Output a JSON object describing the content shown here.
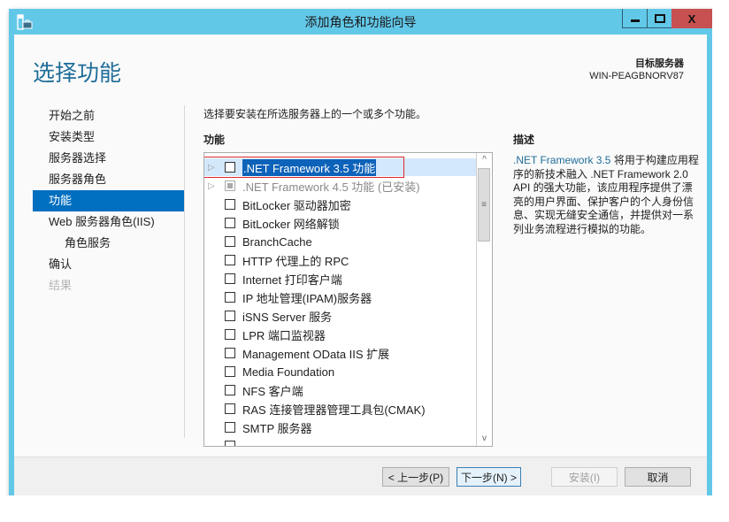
{
  "window": {
    "title": "添加角色和功能向导",
    "controls": {
      "minimize": "▁",
      "maximize": "▫",
      "close": "X"
    },
    "colors": {
      "frame": "#62c8e8",
      "close": "#c75050",
      "accent": "#1f6d99",
      "nav_active": "#006fbf",
      "highlight_box": "#d9262c"
    }
  },
  "header": {
    "page_title": "选择功能",
    "target_label": "目标服务器",
    "target_server": "WIN-PEAGBNORV87"
  },
  "nav": {
    "items": [
      {
        "label": "开始之前",
        "state": "normal"
      },
      {
        "label": "安装类型",
        "state": "normal"
      },
      {
        "label": "服务器选择",
        "state": "normal"
      },
      {
        "label": "服务器角色",
        "state": "normal"
      },
      {
        "label": "功能",
        "state": "active"
      },
      {
        "label": "Web 服务器角色(IIS)",
        "state": "normal"
      },
      {
        "label": "角色服务",
        "state": "sub"
      },
      {
        "label": "确认",
        "state": "normal"
      },
      {
        "label": "结果",
        "state": "disabled"
      }
    ]
  },
  "main": {
    "intro": "选择要安装在所选服务器上的一个或多个功能。",
    "features_heading": "功能",
    "features": [
      {
        "label": ".NET Framework 3.5 功能",
        "expandable": true,
        "checked": false,
        "selected": true
      },
      {
        "label": ".NET Framework 4.5 功能 (已安装)",
        "expandable": true,
        "checked": "installed",
        "selected": false
      },
      {
        "label": "BitLocker 驱动器加密",
        "checked": false
      },
      {
        "label": "BitLocker 网络解锁",
        "checked": false
      },
      {
        "label": "BranchCache",
        "checked": false
      },
      {
        "label": "HTTP 代理上的 RPC",
        "checked": false
      },
      {
        "label": "Internet 打印客户端",
        "checked": false
      },
      {
        "label": "IP 地址管理(IPAM)服务器",
        "checked": false
      },
      {
        "label": "iSNS Server 服务",
        "checked": false
      },
      {
        "label": "LPR 端口监视器",
        "checked": false
      },
      {
        "label": "Management OData IIS 扩展",
        "checked": false
      },
      {
        "label": "Media Foundation",
        "checked": false
      },
      {
        "label": "NFS 客户端",
        "checked": false
      },
      {
        "label": "RAS 连接管理器管理工具包(CMAK)",
        "checked": false
      },
      {
        "label": "SMTP 服务器",
        "checked": false
      }
    ],
    "scrollbar": {
      "up": "^",
      "down": "v",
      "grip": "≡",
      "position_fraction": 0.0
    },
    "description_heading": "描述",
    "description_accent": ".NET Framework 3.5",
    "description_body": " 将用于构建应用程序的新技术融入 .NET Framework 2.0 API 的强大功能，该应用程序提供了漂亮的用户界面、保护客户的个人身份信息、实现无缝安全通信，并提供对一系列业务流程进行模拟的功能。"
  },
  "footer": {
    "prev": "< 上一步(P)",
    "next": "下一步(N) >",
    "install": "安装(I)",
    "cancel": "取消"
  }
}
